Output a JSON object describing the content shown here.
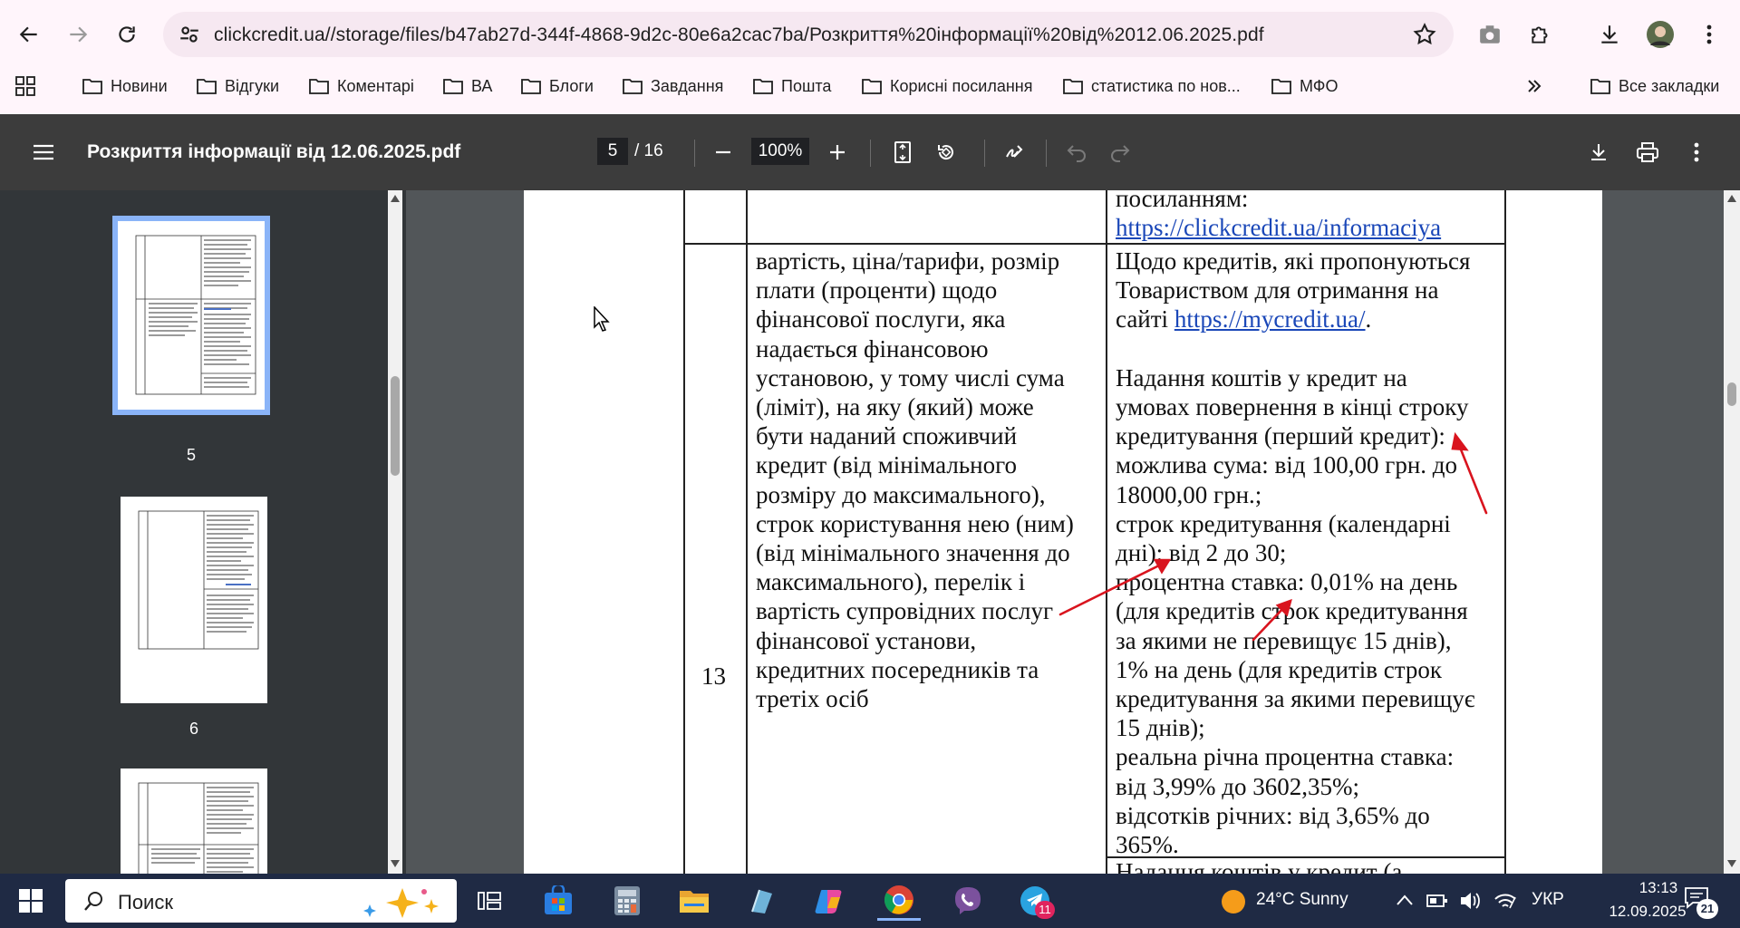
{
  "browser": {
    "url": "clickcredit.ua//storage/files/b47ab27d-344f-4868-9d2c-80e6a2cac7ba/Розкриття%20інформації%20від%2012.06.2025.pdf",
    "bookmarks": [
      "Новини",
      "Відгуки",
      "Коментарі",
      "ВА",
      "Блоги",
      "Завдання",
      "Пошта",
      "Корисні посилання",
      "статистика по нов...",
      "МФО"
    ],
    "all_bookmarks": "Все закладки"
  },
  "pdf": {
    "title": "Розкриття інформації від 12.06.2025.pdf",
    "current_page": "5",
    "total_pages": "/ 16",
    "zoom": "100%"
  },
  "sidebar": {
    "thumbnails": [
      {
        "label": "5",
        "selected": true
      },
      {
        "label": "6",
        "selected": false
      }
    ]
  },
  "document": {
    "top_cell": [
      "посиланням:",
      "https://clickcredit.ua/informaciya"
    ],
    "row_number": "13",
    "left_lines": [
      "вартість, ціна/тарифи, розмір",
      "плати (проценти) щодо",
      "фінансової послуги, яка",
      "надається фінансовою",
      "установою, у тому числі сума",
      "(ліміт), на яку (який) може",
      "бути наданий споживчий",
      "кредит (від мінімального",
      "розміру до максимального),",
      "строк користування нею (ним)",
      "(від мінімального значення до",
      "максимального), перелік і",
      "вартість супровідних послуг",
      "фінансової установи,",
      "кредитних посередників та",
      "третіх осіб"
    ],
    "right_intro": [
      "Щодо кредитів, які пропонуються",
      "Товариством для отримання на",
      "сайті"
    ],
    "right_intro_link": "https://mycredit.ua/",
    "right_intro_end": ".",
    "right_lines": [
      "Надання коштів у кредит на",
      "умовах повернення в кінці строку",
      "кредитування (перший кредит):",
      "можлива сума: від 100,00 грн. до",
      "18000,00 грн.;",
      "строк кредитування (календарні",
      "дні): від 2 до 30;",
      "процентна ставка: 0,01% на день",
      "(для кредитів строк кредитування",
      "за якими не перевищує 15 днів),",
      "1% на день (для кредитів строк",
      "кредитування за якими перевищує",
      "15 днів);",
      "реальна річна процентна ставка:",
      "від 3,99% до 3602,35%;",
      "відсотків річних: від 3,65% до",
      "365%."
    ],
    "next_cell": "Надання коштів у кредит (а"
  },
  "taskbar": {
    "search": "Поиск",
    "weather": "24°C  Sunny",
    "language": "УКР",
    "time": "13:13",
    "date": "12.09.2025",
    "telegram_badge": "11",
    "notifications": "21"
  },
  "colors": {
    "accent_blue": "#8ab4f8",
    "link": "#1a47b8",
    "annotation_red": "#d9141e"
  }
}
